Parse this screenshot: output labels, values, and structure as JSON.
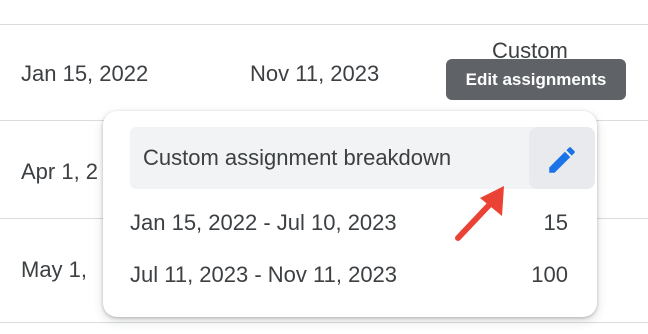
{
  "table": {
    "rows": [
      {
        "start": "Jan 15, 2022",
        "end": "Nov 11, 2023",
        "type": "Custom"
      },
      {
        "start": "Apr 1, 2"
      },
      {
        "start": "May 1,"
      }
    ]
  },
  "tooltip": {
    "label": "Edit assignments"
  },
  "popover": {
    "title": "Custom assignment breakdown",
    "edit_icon": "pencil-icon",
    "rows": [
      {
        "range": "Jan 15, 2022 - Jul 10, 2023",
        "count": "15"
      },
      {
        "range": "Jul 11, 2023 - Nov 11, 2023",
        "count": "100"
      }
    ]
  },
  "colors": {
    "accent_blue": "#1a73e8",
    "annotation_arrow": "#ea4335",
    "tooltip_bg": "#5f6368"
  }
}
